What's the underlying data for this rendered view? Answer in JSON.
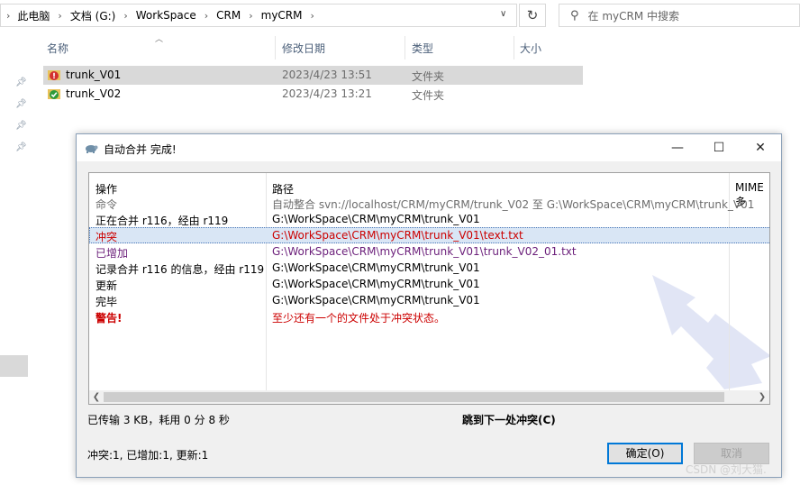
{
  "explorer": {
    "breadcrumb": [
      "此电脑",
      "文档 (G:)",
      "WorkSpace",
      "CRM",
      "myCRM"
    ],
    "search_placeholder": "在 myCRM 中搜索",
    "columns": {
      "name": "名称",
      "date": "修改日期",
      "type": "类型",
      "size": "大小"
    },
    "files": [
      {
        "name": "trunk_V01",
        "date": "2023/4/23 13:51",
        "type": "文件夹",
        "status": "conflict"
      },
      {
        "name": "trunk_V02",
        "date": "2023/4/23 13:21",
        "type": "文件夹",
        "status": "normal"
      }
    ]
  },
  "dialog": {
    "title": "自动合并 完成!",
    "headers": {
      "action": "操作",
      "path": "路径",
      "mime": "MIME 多"
    },
    "rows": [
      {
        "action": "命令",
        "path": "自动整合 svn://localhost/CRM/myCRM/trunk_V02 至 G:\\WorkSpace\\CRM\\myCRM\\trunk_V01",
        "color": "#6d6d6d"
      },
      {
        "action": "正在合并 r116，经由 r119",
        "path": "G:\\WorkSpace\\CRM\\myCRM\\trunk_V01",
        "color": "#000000"
      },
      {
        "action": "冲突",
        "path": "G:\\WorkSpace\\CRM\\myCRM\\trunk_V01\\text.txt",
        "color": "#cc0000"
      },
      {
        "action": "已增加",
        "path": "G:\\WorkSpace\\CRM\\myCRM\\trunk_V01\\trunk_V02_01.txt",
        "color": "#6b1f7a"
      },
      {
        "action": "记录合并 r116 的信息，经由 r119",
        "path": "G:\\WorkSpace\\CRM\\myCRM\\trunk_V01",
        "color": "#000000"
      },
      {
        "action": "更新",
        "path": "G:\\WorkSpace\\CRM\\myCRM\\trunk_V01",
        "color": "#000000"
      },
      {
        "action": "完毕",
        "path": "G:\\WorkSpace\\CRM\\myCRM\\trunk_V01",
        "color": "#000000"
      },
      {
        "action": "警告!",
        "path": "至少还有一个的文件处于冲突状态。",
        "color": "#cc0000"
      }
    ],
    "transfer_info": "已传输 3 KB，耗用 0 分 8 秒",
    "next_conflict_label": "跳到下一处冲突(C)",
    "summary": "冲突:1, 已增加:1, 更新:1",
    "ok_label": "确定(O)",
    "cancel_label": "取消"
  },
  "watermark": "CSDN @刘大猫."
}
